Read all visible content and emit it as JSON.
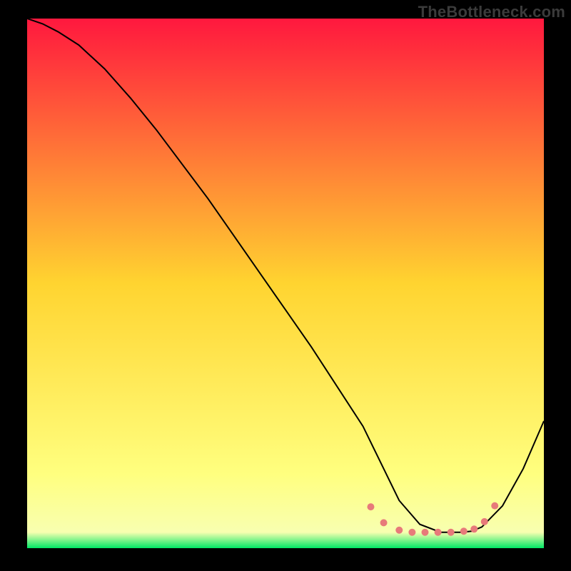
{
  "watermark": "TheBottleneck.com",
  "chart_data": {
    "type": "line",
    "title": "",
    "xlabel": "",
    "ylabel": "",
    "xlim": [
      0,
      100
    ],
    "ylim": [
      0,
      100
    ],
    "grid": false,
    "legend": false,
    "background_gradient": {
      "top_color": "#ff183e",
      "mid_color": "#ffd430",
      "lower_band_color": "#ffff7f",
      "bottom_color": "#00e865"
    },
    "series": [
      {
        "name": "curve",
        "color": "#000000",
        "x": [
          0,
          3,
          6,
          10,
          15,
          20,
          25,
          30,
          35,
          40,
          45,
          50,
          55,
          60,
          65,
          67,
          69,
          72,
          76,
          80,
          84,
          86,
          88,
          92,
          96,
          100
        ],
        "y": [
          100,
          99,
          97.5,
          95,
          90.5,
          85,
          79,
          72.5,
          66,
          59,
          52,
          45,
          38,
          30.5,
          23,
          19,
          15,
          9,
          4.5,
          3,
          3,
          3.2,
          4,
          8,
          15,
          24
        ]
      }
    ],
    "markers": {
      "name": "highlight-dots",
      "color": "#e77a7a",
      "radius": 5,
      "x": [
        66.5,
        69,
        72,
        74.5,
        77,
        79.5,
        82,
        84.5,
        86.5,
        88.5,
        90.5
      ],
      "y": [
        7.8,
        4.8,
        3.4,
        3.0,
        3.0,
        3.0,
        3.0,
        3.2,
        3.6,
        5.0,
        8.0
      ]
    }
  }
}
